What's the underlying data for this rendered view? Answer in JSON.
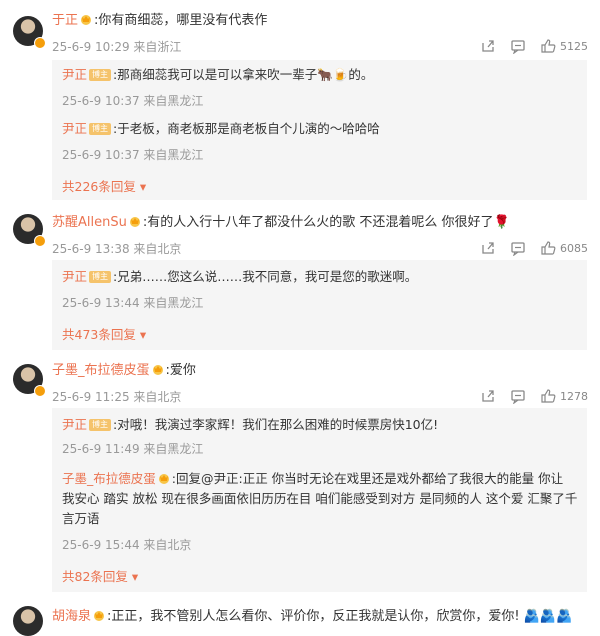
{
  "comments": [
    {
      "user": "于正",
      "text": ":你有商细蕊，哪里没有代表作",
      "meta": "25-6-9 10:29 来自浙江",
      "likes": "5125",
      "replies": [
        {
          "user": "尹正",
          "tag": "博主",
          "text": ":那商细蕊我可以是可以拿来吹一辈子🐂🍺的。",
          "meta": "25-6-9 10:37 来自黑龙江"
        },
        {
          "user": "尹正",
          "tag": "博主",
          "text": ":于老板，商老板那是商老板自个儿演的～哈哈哈",
          "meta": "25-6-9 10:37 来自黑龙江"
        }
      ],
      "more": "共226条回复"
    },
    {
      "user": "苏醒AllenSu",
      "text": ":有的人入行十八年了都没什么火的歌 不还混着呢么 你很好了🌹",
      "meta": "25-6-9 13:38 来自北京",
      "likes": "6085",
      "replies": [
        {
          "user": "尹正",
          "tag": "博主",
          "text": ":兄弟……您这么说……我不同意，我可是您的歌迷啊。",
          "meta": "25-6-9 13:44 来自黑龙江"
        }
      ],
      "more": "共473条回复"
    },
    {
      "user": "子墨_布拉德皮蛋",
      "text": ":爱你",
      "meta": "25-6-9 11:25 来自北京",
      "likes": "1278",
      "replies": [
        {
          "user": "尹正",
          "tag": "博主",
          "text": ":对哦！我演过李家辉！我们在那么困难的时候票房快10亿!",
          "meta": "25-6-9 11:49 来自黑龙江"
        },
        {
          "user": "子墨_布拉德皮蛋",
          "text": ":回复@尹正:正正 你当时无论在戏里还是戏外都给了我很大的能量 你让",
          "text2": "我安心 踏实 放松 现在很多画面依旧历历在目 咱们能感受到对方 是同频的人 这个爱 汇聚了千",
          "text3": "言万语",
          "meta": "25-6-9 15:44 来自北京"
        }
      ],
      "more": "共82条回复"
    },
    {
      "user": "胡海泉",
      "text": ":正正，我不管别人怎么看你、评价你，反正我就是认你，欣赏你，爱你! 🫂🫂🫂"
    }
  ]
}
